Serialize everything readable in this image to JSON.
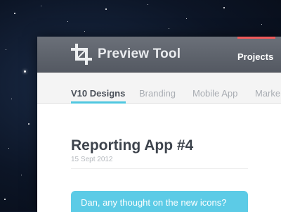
{
  "app": {
    "title": "Preview Tool",
    "nav": {
      "projects_label": "Projects"
    },
    "accent_color": "#f05a5a"
  },
  "tabs": [
    {
      "label": "V10 Designs",
      "active": true
    },
    {
      "label": "Branding",
      "active": false
    },
    {
      "label": "Mobile App",
      "active": false
    },
    {
      "label": "Marke",
      "active": false
    }
  ],
  "tab_underline_color": "#4fc7e0",
  "post": {
    "title": "Reporting App #4",
    "date": "15 Sept 2012"
  },
  "comment": {
    "text": "Dan, any thought on the new icons?",
    "color": "#5ccbe6"
  },
  "icons": {
    "logo": "crop-icon"
  }
}
